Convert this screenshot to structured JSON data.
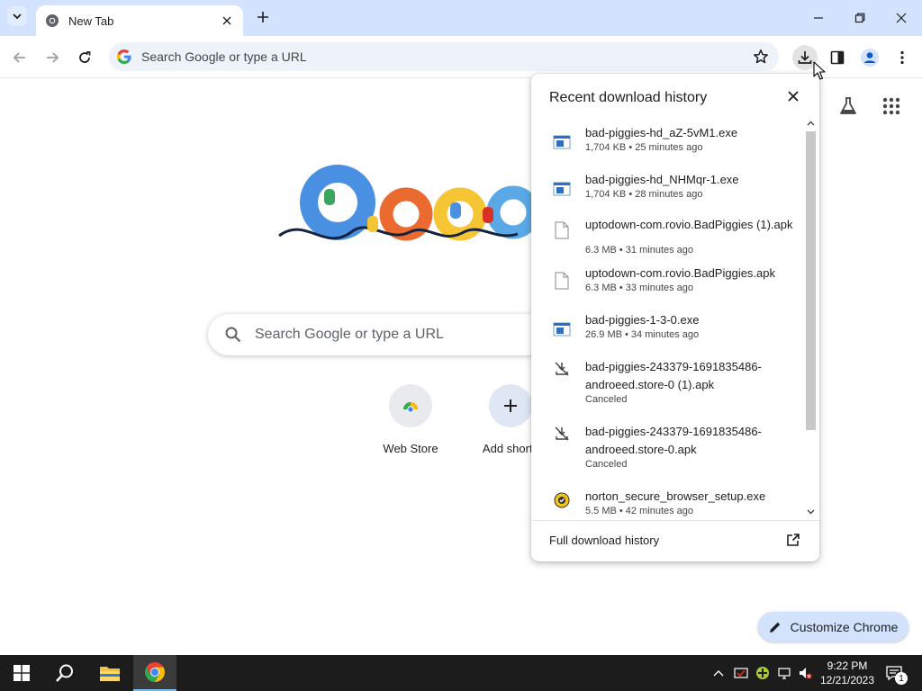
{
  "browser": {
    "tab": {
      "title": "New Tab"
    },
    "omnibox": {
      "placeholder": "Search Google or type a URL"
    }
  },
  "ntp": {
    "search_placeholder": "Search Google or type a URL",
    "shortcuts": [
      {
        "label": "Web Store",
        "icon": "chrome-web-store-icon"
      },
      {
        "label": "Add shortc",
        "icon": "plus-icon"
      }
    ],
    "customize_label": "Customize Chrome"
  },
  "downloads": {
    "title": "Recent download history",
    "items": [
      {
        "name": "bad-piggies-hd_aZ-5vM1.exe",
        "meta": "1,704 KB • 25 minutes ago",
        "icon": "exe-file-icon"
      },
      {
        "name": "bad-piggies-hd_NHMqr-1.exe",
        "meta": "1,704 KB • 28 minutes ago",
        "icon": "exe-file-icon"
      },
      {
        "name": "uptodown-com.rovio.BadPiggies (1).apk",
        "meta": "6.3 MB • 31 minutes ago",
        "icon": "generic-file-icon"
      },
      {
        "name": "uptodown-com.rovio.BadPiggies.apk",
        "meta": "6.3 MB • 33 minutes ago",
        "icon": "generic-file-icon"
      },
      {
        "name": "bad-piggies-1-3-0.exe",
        "meta": "26.9 MB • 34 minutes ago",
        "icon": "exe-file-icon"
      },
      {
        "name": "bad-piggies-243379-1691835486-androeed.store-0 (1).apk",
        "meta": "Canceled",
        "icon": "canceled-download-icon"
      },
      {
        "name": "bad-piggies-243379-1691835486-androeed.store-0.apk",
        "meta": "Canceled",
        "icon": "canceled-download-icon"
      },
      {
        "name": "norton_secure_browser_setup.exe",
        "meta": "5.5 MB • 42 minutes ago",
        "icon": "norton-file-icon"
      }
    ],
    "full_history_label": "Full download history"
  },
  "taskbar": {
    "time": "9:22 PM",
    "date": "12/21/2023",
    "notification_count": "1"
  },
  "colors": {
    "tabstrip": "#d3e3fd",
    "omnibox": "#eef2f9",
    "taskbar": "#1c1c1c",
    "accent": "#0b57d0"
  }
}
